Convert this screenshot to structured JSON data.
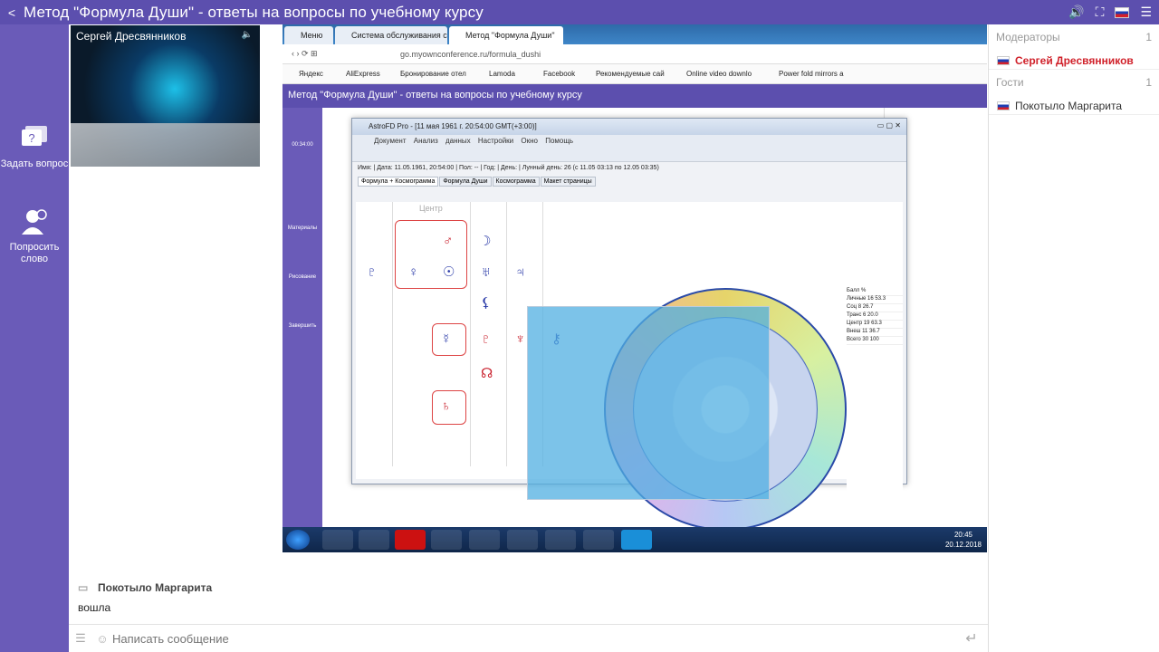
{
  "topbar": {
    "title": "Метод \"Формула Души\" - ответы на вопросы по учебному курсу"
  },
  "rail": {
    "ask_question": "Задать вопрос",
    "ask_word": "Попросить слово"
  },
  "webcam": {
    "presenter_name": "Сергей Дресвянников"
  },
  "right_panel": {
    "moderators_label": "Модераторы",
    "moderators_count": "1",
    "moderator_name": "Сергей Дресвянников",
    "guests_label": "Гости",
    "guests_count": "1",
    "guest_name": "Покотыло Маргарита"
  },
  "chat": {
    "last_author": "Покотыло Маргарита",
    "last_text": "вошла",
    "input_placeholder": "Написать сообщение"
  },
  "screen": {
    "tabs": [
      "Меню",
      "Система обслуживания с",
      "Метод \"Формула Души\""
    ],
    "address": "go.myownconference.ru/formula_dushi",
    "bookmarks": [
      "Яндекс",
      "AliExpress",
      "Бронирование отел",
      "Lamoda",
      "Facebook",
      "Рекомендуемые сай",
      "Online video downlo",
      "Power fold mirrors a"
    ],
    "inner_title": "Метод \"Формула Души\" - ответы на вопросы по учебному курсу",
    "inner_rail": [
      "Материалы",
      "Рисование",
      "Завершить"
    ],
    "inner_timer": "00:34:00",
    "taskbar_time": "20:45",
    "taskbar_date": "20.12.2018"
  },
  "astro": {
    "title": "AstroFD Pro - [11 мая 1961 г. 20:54:00 GMT(+3:00)]",
    "menu": [
      "Документ",
      "Анализ данных",
      "Настройки",
      "Окно",
      "Помощь"
    ],
    "form_line": "Имя: | Дата: 11.05.1961, 20:54:00 | Пол: -- | Год: | День: | Лунный день: 26 (с 11.05 03:13 по 12.05 03:35)",
    "tabs": [
      "Формула + Космограмма",
      "Формула Души",
      "Космограмма",
      "Макет страницы"
    ],
    "center_label": "Центр",
    "stats_rows": [
      "Балл %",
      "Личные 16 53.3",
      "Соц 8 26.7",
      "Транс 6 20.0",
      "Центр 19 63.3",
      "Внеш 11 36.7",
      "Всего 30 100"
    ]
  }
}
